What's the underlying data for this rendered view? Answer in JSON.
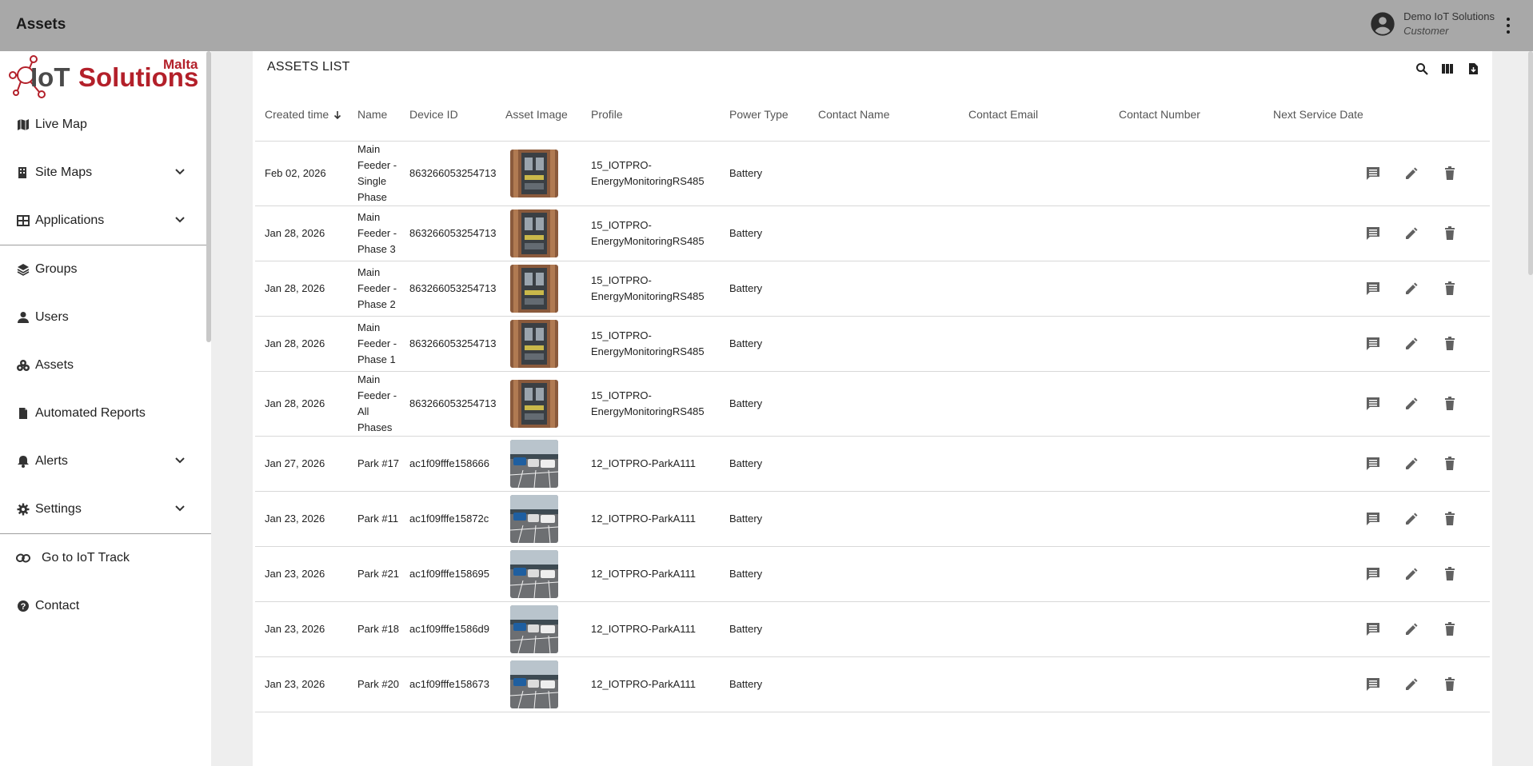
{
  "app": {
    "title": "Assets"
  },
  "user": {
    "name": "Demo IoT Solutions",
    "role": "Customer"
  },
  "logo": {
    "text_main": "IoT Solutions",
    "text_top": "Malta"
  },
  "sidebar": {
    "items": [
      {
        "label": "Live Map",
        "icon": "map-icon",
        "expandable": false
      },
      {
        "label": "Site Maps",
        "icon": "building-icon",
        "expandable": true
      },
      {
        "label": "Applications",
        "icon": "grid-icon",
        "expandable": true
      },
      {
        "label": "Groups",
        "icon": "layers-icon",
        "expandable": false
      },
      {
        "label": "Users",
        "icon": "person-icon",
        "expandable": false
      },
      {
        "label": "Assets",
        "icon": "assets-icon",
        "expandable": false
      },
      {
        "label": "Automated Reports",
        "icon": "file-icon",
        "expandable": false
      },
      {
        "label": "Alerts",
        "icon": "bell-icon",
        "expandable": true
      },
      {
        "label": "Settings",
        "icon": "gear-icon",
        "expandable": true
      },
      {
        "label": "Go to IoT Track",
        "icon": "link-icon",
        "expandable": false
      },
      {
        "label": "Contact",
        "icon": "help-icon",
        "expandable": false
      }
    ]
  },
  "list": {
    "title": "ASSETS LIST",
    "columns": {
      "created": "Created time",
      "name": "Name",
      "device": "Device ID",
      "image": "Asset Image",
      "profile": "Profile",
      "power": "Power Type",
      "contact_name": "Contact Name",
      "contact_email": "Contact Email",
      "contact_number": "Contact Number",
      "next_service": "Next Service Date"
    },
    "rows": [
      {
        "created": "Feb 02, 2026",
        "name": "Main Feeder - Single Phase",
        "device": "863266053254713",
        "image": "electrical-panel",
        "profile": "15_IOTPRO-EnergyMonitoringRS485",
        "power": "Battery"
      },
      {
        "created": "Jan 28, 2026",
        "name": "Main Feeder - Phase 3",
        "device": "863266053254713",
        "image": "electrical-panel",
        "profile": "15_IOTPRO-EnergyMonitoringRS485",
        "power": "Battery"
      },
      {
        "created": "Jan 28, 2026",
        "name": "Main Feeder - Phase 2",
        "device": "863266053254713",
        "image": "electrical-panel",
        "profile": "15_IOTPRO-EnergyMonitoringRS485",
        "power": "Battery"
      },
      {
        "created": "Jan 28, 2026",
        "name": "Main Feeder - Phase 1",
        "device": "863266053254713",
        "image": "electrical-panel",
        "profile": "15_IOTPRO-EnergyMonitoringRS485",
        "power": "Battery"
      },
      {
        "created": "Jan 28, 2026",
        "name": "Main Feeder - All Phases",
        "device": "863266053254713",
        "image": "electrical-panel",
        "profile": "15_IOTPRO-EnergyMonitoringRS485",
        "power": "Battery"
      },
      {
        "created": "Jan 27, 2026",
        "name": "Park #17",
        "device": "ac1f09fffe158666",
        "image": "parking-lot",
        "profile": "12_IOTPRO-ParkA111",
        "power": "Battery"
      },
      {
        "created": "Jan 23, 2026",
        "name": "Park #11",
        "device": "ac1f09fffe15872c",
        "image": "parking-lot",
        "profile": "12_IOTPRO-ParkA111",
        "power": "Battery"
      },
      {
        "created": "Jan 23, 2026",
        "name": "Park #21",
        "device": "ac1f09fffe158695",
        "image": "parking-lot",
        "profile": "12_IOTPRO-ParkA111",
        "power": "Battery"
      },
      {
        "created": "Jan 23, 2026",
        "name": "Park #18",
        "device": "ac1f09fffe1586d9",
        "image": "parking-lot",
        "profile": "12_IOTPRO-ParkA111",
        "power": "Battery"
      },
      {
        "created": "Jan 23, 2026",
        "name": "Park #20",
        "device": "ac1f09fffe158673",
        "image": "parking-lot",
        "profile": "12_IOTPRO-ParkA111",
        "power": "Battery"
      }
    ]
  },
  "colors": {
    "topbar": "#a8a8a8",
    "logo_red": "#b3202a",
    "icon_gray": "#616161"
  }
}
